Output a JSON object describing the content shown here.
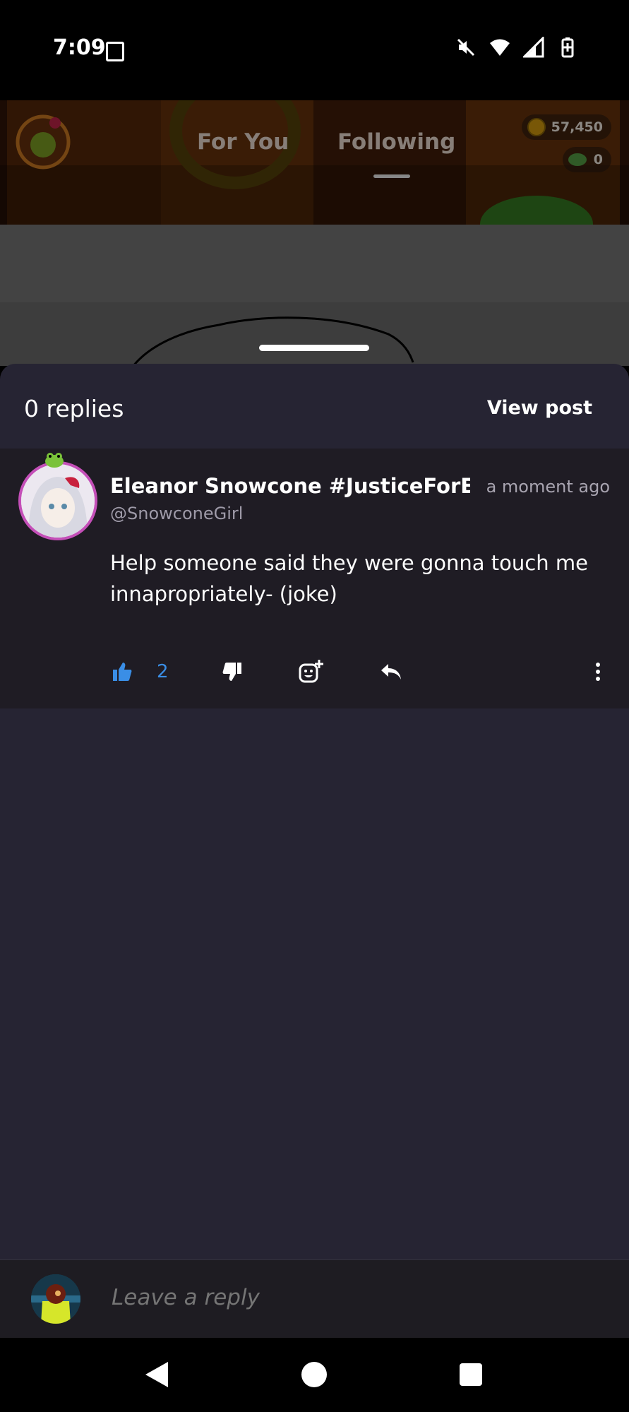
{
  "status_bar": {
    "time": "7:09"
  },
  "top_nav": {
    "tabs": [
      {
        "label": "For You"
      },
      {
        "label": "Following"
      }
    ],
    "coins": "57,450",
    "gems": "0"
  },
  "sheet": {
    "replies_label": "0 replies",
    "view_post_label": "View post"
  },
  "comment": {
    "author": "Eleanor Snowcone #JusticeForEl",
    "handle": "@SnowconeGirl",
    "time": "a moment ago",
    "body": "Help someone said they were gonna touch me innapropriately- (joke)",
    "likes": "2"
  },
  "reply_bar": {
    "placeholder": "Leave a reply"
  }
}
